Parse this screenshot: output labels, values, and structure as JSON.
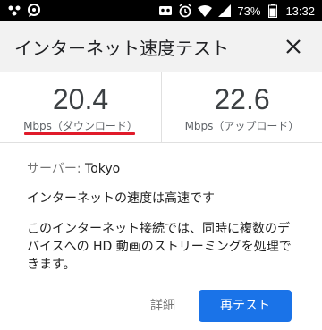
{
  "status_bar": {
    "battery_percent": "73%",
    "time": "13:32",
    "icons": [
      "device-icon",
      "chat-bubble-icon",
      "cassette-icon",
      "alarm-icon",
      "wifi-icon",
      "signal-icon",
      "battery-icon"
    ]
  },
  "header": {
    "title": "インターネット速度テスト",
    "close_icon": "close-icon"
  },
  "speeds": {
    "download": {
      "value": "20.4",
      "label": "Mbps（ダウンロード）"
    },
    "upload": {
      "value": "22.6",
      "label": "Mbps（アップロード）"
    },
    "accent_color": "#e01b2a"
  },
  "body": {
    "server_label": "サーバー: ",
    "server_value": "Tokyo",
    "summary": "インターネットの速度は高速です",
    "description": "このインターネット接続では、同時に複数のデバイスへの HD 動画のストリーミングを処理できます。"
  },
  "actions": {
    "details_label": "詳細",
    "retest_label": "再テスト",
    "primary_color": "#1a73e8"
  }
}
